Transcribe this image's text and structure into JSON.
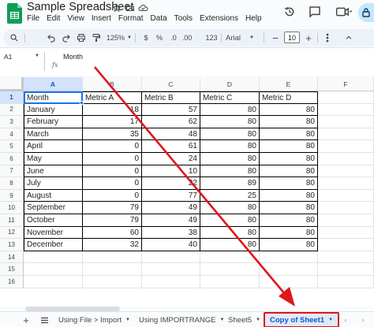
{
  "app": {
    "title": "Sample Spreadsheet",
    "menu": [
      "File",
      "Edit",
      "View",
      "Insert",
      "Format",
      "Data",
      "Tools",
      "Extensions",
      "Help"
    ],
    "brand_color": "#0f9d58",
    "accent_color": "#1a73e8",
    "annotation_color": "#e0161a"
  },
  "toolbar": {
    "zoom": "125%",
    "currency": "$",
    "percent": "%",
    "decrease_decimal": ".0",
    "increase_decimal": ".00",
    "number_format": "123",
    "font": "Arial",
    "font_size": "10",
    "minus": "−",
    "plus": "+"
  },
  "formula_bar": {
    "name_box": "A1",
    "fx": "fx",
    "value": "Month"
  },
  "grid": {
    "columns": [
      "A",
      "B",
      "C",
      "D",
      "E",
      "F"
    ],
    "rows": [
      "1",
      "2",
      "3",
      "4",
      "5",
      "6",
      "7",
      "8",
      "9",
      "10",
      "11",
      "12",
      "13",
      "14",
      "15",
      "16"
    ],
    "header": [
      "Month",
      "Metric A",
      "Metric B",
      "Metric C",
      "Metric D"
    ],
    "data": [
      [
        "January",
        "18",
        "57",
        "80",
        "80"
      ],
      [
        "February",
        "17",
        "62",
        "80",
        "80"
      ],
      [
        "March",
        "35",
        "48",
        "80",
        "80"
      ],
      [
        "April",
        "0",
        "61",
        "80",
        "80"
      ],
      [
        "May",
        "0",
        "24",
        "80",
        "80"
      ],
      [
        "June",
        "0",
        "10",
        "80",
        "80"
      ],
      [
        "July",
        "0",
        "22",
        "89",
        "80"
      ],
      [
        "August",
        "0",
        "77",
        "25",
        "80"
      ],
      [
        "September",
        "79",
        "49",
        "80",
        "80"
      ],
      [
        "October",
        "79",
        "49",
        "80",
        "80"
      ],
      [
        "November",
        "60",
        "38",
        "80",
        "80"
      ],
      [
        "December",
        "32",
        "40",
        "80",
        "80"
      ]
    ]
  },
  "sheets": {
    "tabs": [
      "Using File > Import",
      "Using IMPORTRANGE",
      "Sheet5",
      "Copy of Sheet1"
    ],
    "active": "Copy of Sheet1"
  }
}
